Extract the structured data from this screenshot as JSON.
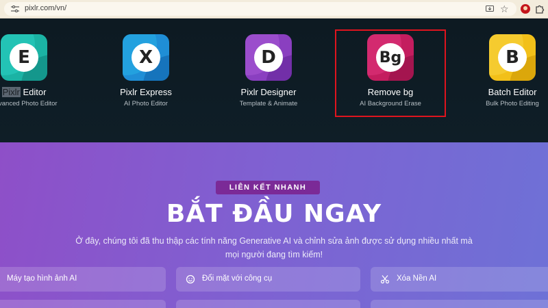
{
  "browser": {
    "url": "pixlr.com/vn/"
  },
  "apps": [
    {
      "name": "Pixlr Editor",
      "name_highlight": "Pixlr",
      "name_rest": " Editor",
      "subtitle": "Advanced Photo Editor",
      "letter": "E",
      "colors": [
        "#1bb3a4",
        "#2ad0c2",
        "#0f8078"
      ]
    },
    {
      "name": "Pixlr Express",
      "subtitle": "AI Photo Editor",
      "letter": "X",
      "colors": [
        "#1f8ed6",
        "#27b1e8",
        "#0f5fa8"
      ]
    },
    {
      "name": "Pixlr Designer",
      "subtitle": "Template & Animate",
      "letter": "D",
      "colors": [
        "#8a3fc0",
        "#a95ad6",
        "#5e2394"
      ]
    },
    {
      "name": "Remove bg",
      "subtitle": "AI Background Erase",
      "letter": "Bg",
      "colors": [
        "#c41d5f",
        "#e0357c",
        "#8a0f42"
      ]
    },
    {
      "name": "Batch Editor",
      "subtitle": "Bulk Photo Editing",
      "letter": "B",
      "colors": [
        "#f2c019",
        "#f8d441",
        "#c99200"
      ]
    }
  ],
  "quick_links": {
    "pill": "LIÊN KẾT NHANH",
    "title": "BẮT ĐẦU NGAY",
    "description": "Ở đây, chúng tôi đã thu thập các tính năng Generative AI và chỉnh sửa ảnh được sử dụng nhiều nhất mà mọi người đang tìm kiếm!",
    "cards": [
      {
        "label": "Máy tạo hình ảnh AI",
        "icon": "sparkle-icon"
      },
      {
        "label": "Đổi mặt với công cụ",
        "icon": "face-icon"
      },
      {
        "label": "Xóa Nền AI",
        "icon": "scissors-icon"
      }
    ]
  }
}
